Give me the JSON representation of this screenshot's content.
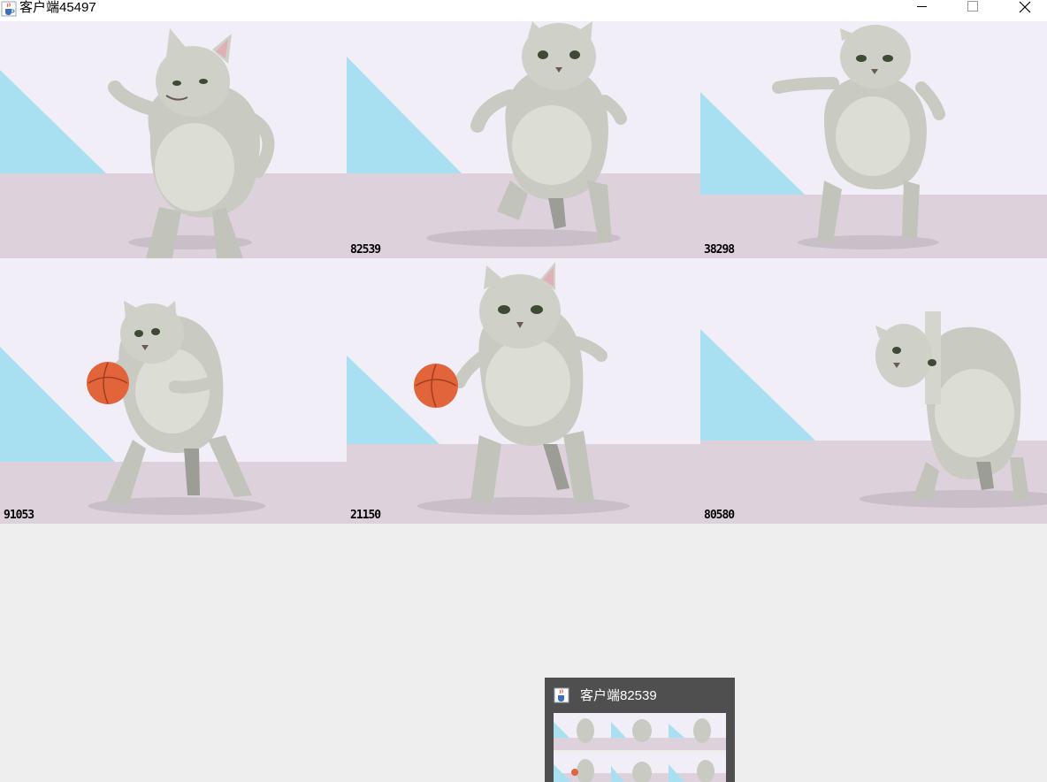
{
  "window": {
    "title": "客户端45497",
    "icon": "java-coffee-icon",
    "controls": [
      "minimize-icon",
      "maximize-icon",
      "close-icon"
    ]
  },
  "grid": {
    "tiles": [
      {
        "label": "",
        "pose": "arm-raised"
      },
      {
        "label": "82539",
        "pose": "walking-front"
      },
      {
        "label": "38298",
        "pose": "arms-out"
      },
      {
        "label": "91053",
        "pose": "dribbling-left"
      },
      {
        "label": "21150",
        "pose": "dribbling-front"
      },
      {
        "label": "80580",
        "pose": "split-glitch"
      }
    ]
  },
  "popup": {
    "title": "客户端82539",
    "icon": "java-coffee-icon"
  },
  "colors": {
    "wall": "#f1eef8",
    "floor": "#ddd2dc",
    "triangle": "#a8e0f2",
    "cat": "#c9cbc2",
    "ball": "#e2643a",
    "background": "#eeeeee",
    "popup": "#4f4f4f"
  }
}
